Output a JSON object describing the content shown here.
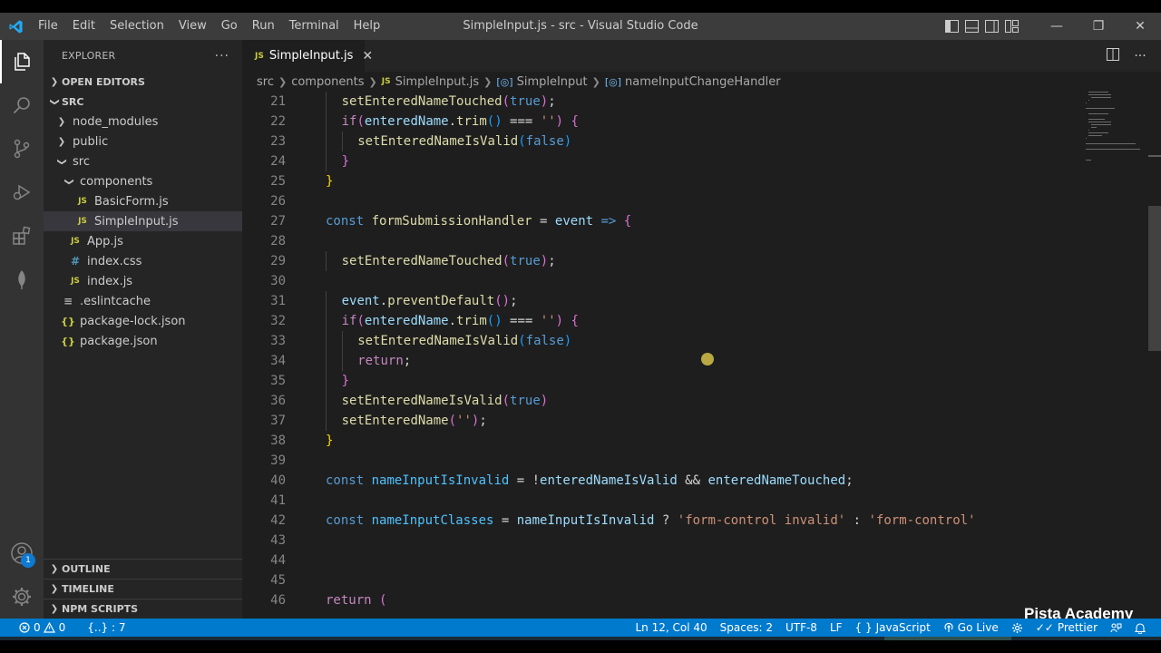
{
  "window": {
    "title": "SimpleInput.js - src - Visual Studio Code",
    "menu": [
      "File",
      "Edit",
      "Selection",
      "View",
      "Go",
      "Run",
      "Terminal",
      "Help"
    ],
    "controls": {
      "minimize": "—",
      "restore": "❐",
      "close": "✕"
    }
  },
  "activity_bar": {
    "items": [
      "explorer-icon",
      "search-icon",
      "source-control-icon",
      "run-debug-icon",
      "extensions-icon",
      "mongodb-leaf-icon"
    ],
    "bottom": [
      "account-icon",
      "settings-gear-icon"
    ],
    "account_badge": "1"
  },
  "sidebar": {
    "title": "EXPLORER",
    "more": "···",
    "open_editors": "OPEN EDITORS",
    "root": "SRC",
    "tree": [
      {
        "label": "node_modules",
        "type": "folder",
        "indent": 1,
        "expanded": false
      },
      {
        "label": "public",
        "type": "folder",
        "indent": 1,
        "expanded": false
      },
      {
        "label": "src",
        "type": "folder",
        "indent": 1,
        "expanded": true
      },
      {
        "label": "components",
        "type": "folder",
        "indent": 2,
        "expanded": true
      },
      {
        "label": "BasicForm.js",
        "type": "js",
        "indent": 3
      },
      {
        "label": "SimpleInput.js",
        "type": "js",
        "indent": 3,
        "selected": true
      },
      {
        "label": "App.js",
        "type": "js",
        "indent": 2
      },
      {
        "label": "index.css",
        "type": "css",
        "indent": 2
      },
      {
        "label": "index.js",
        "type": "js",
        "indent": 2
      },
      {
        "label": ".eslintcache",
        "type": "plain",
        "indent": 1
      },
      {
        "label": "package-lock.json",
        "type": "json",
        "indent": 1
      },
      {
        "label": "package.json",
        "type": "json",
        "indent": 1
      }
    ],
    "bottom_sections": [
      "OUTLINE",
      "TIMELINE",
      "NPM SCRIPTS"
    ]
  },
  "tab": {
    "icon": "JS",
    "label": "SimpleInput.js",
    "close": "✕"
  },
  "breadcrumbs": {
    "parts": [
      "src",
      "components",
      "SimpleInput.js",
      "SimpleInput",
      "nameInputChangeHandler"
    ]
  },
  "editor": {
    "lines": [
      {
        "n": "21",
        "indent": 1,
        "tokens": [
          [
            "fn",
            "setEnteredNameTouched"
          ],
          [
            "p2",
            "("
          ],
          [
            "kw",
            "true"
          ],
          [
            "p2",
            ")"
          ],
          [
            "op",
            ";"
          ]
        ]
      },
      {
        "n": "22",
        "indent": 1,
        "tokens": [
          [
            "ctrl",
            "if"
          ],
          [
            "p2",
            "("
          ],
          [
            "var",
            "enteredName"
          ],
          [
            "op",
            "."
          ],
          [
            "fn",
            "trim"
          ],
          [
            "p3",
            "()"
          ],
          [
            "op",
            " === "
          ],
          [
            "str",
            "''"
          ],
          [
            "p2",
            ")"
          ],
          [
            "op",
            " "
          ],
          [
            "p2",
            "{"
          ]
        ]
      },
      {
        "n": "23",
        "indent": 2,
        "tokens": [
          [
            "fn",
            "setEnteredNameIsValid"
          ],
          [
            "p3",
            "("
          ],
          [
            "kw",
            "false"
          ],
          [
            "p3",
            ")"
          ]
        ]
      },
      {
        "n": "24",
        "indent": 1,
        "tokens": [
          [
            "p2",
            "}"
          ]
        ]
      },
      {
        "n": "25",
        "indent": 0,
        "tokens": [
          [
            "p1",
            "}"
          ]
        ]
      },
      {
        "n": "26",
        "indent": 0,
        "tokens": []
      },
      {
        "n": "27",
        "indent": 0,
        "tokens": [
          [
            "kw",
            "const"
          ],
          [
            "op",
            " "
          ],
          [
            "fn",
            "formSubmissionHandler"
          ],
          [
            "op",
            " = "
          ],
          [
            "var",
            "event"
          ],
          [
            "op",
            " "
          ],
          [
            "kw",
            "=>"
          ],
          [
            "op",
            " "
          ],
          [
            "p2",
            "{"
          ]
        ]
      },
      {
        "n": "28",
        "indent": 0,
        "tokens": []
      },
      {
        "n": "29",
        "indent": 1,
        "tokens": [
          [
            "fn",
            "setEnteredNameTouched"
          ],
          [
            "p2",
            "("
          ],
          [
            "kw",
            "true"
          ],
          [
            "p2",
            ")"
          ],
          [
            "op",
            ";"
          ]
        ]
      },
      {
        "n": "30",
        "indent": 0,
        "tokens": []
      },
      {
        "n": "31",
        "indent": 1,
        "tokens": [
          [
            "var",
            "event"
          ],
          [
            "op",
            "."
          ],
          [
            "fn",
            "preventDefault"
          ],
          [
            "p2",
            "()"
          ],
          [
            "op",
            ";"
          ]
        ]
      },
      {
        "n": "32",
        "indent": 1,
        "tokens": [
          [
            "ctrl",
            "if"
          ],
          [
            "p2",
            "("
          ],
          [
            "var",
            "enteredName"
          ],
          [
            "op",
            "."
          ],
          [
            "fn",
            "trim"
          ],
          [
            "p3",
            "()"
          ],
          [
            "op",
            " === "
          ],
          [
            "str",
            "''"
          ],
          [
            "p2",
            ")"
          ],
          [
            "op",
            " "
          ],
          [
            "p2",
            "{"
          ]
        ]
      },
      {
        "n": "33",
        "indent": 2,
        "tokens": [
          [
            "fn",
            "setEnteredNameIsValid"
          ],
          [
            "p3",
            "("
          ],
          [
            "kw",
            "false"
          ],
          [
            "p3",
            ")"
          ]
        ]
      },
      {
        "n": "34",
        "indent": 2,
        "tokens": [
          [
            "ctrl",
            "return"
          ],
          [
            "op",
            ";"
          ]
        ]
      },
      {
        "n": "35",
        "indent": 1,
        "tokens": [
          [
            "p2",
            "}"
          ]
        ]
      },
      {
        "n": "36",
        "indent": 1,
        "tokens": [
          [
            "fn",
            "setEnteredNameIsValid"
          ],
          [
            "p2",
            "("
          ],
          [
            "kw",
            "true"
          ],
          [
            "p2",
            ")"
          ]
        ]
      },
      {
        "n": "37",
        "indent": 1,
        "tokens": [
          [
            "fn",
            "setEnteredName"
          ],
          [
            "p2",
            "("
          ],
          [
            "str",
            "''"
          ],
          [
            "p2",
            ")"
          ],
          [
            "op",
            ";"
          ]
        ]
      },
      {
        "n": "38",
        "indent": 0,
        "tokens": [
          [
            "p1",
            "}"
          ]
        ]
      },
      {
        "n": "39",
        "indent": 0,
        "tokens": []
      },
      {
        "n": "40",
        "indent": 0,
        "tokens": [
          [
            "kw",
            "const"
          ],
          [
            "op",
            " "
          ],
          [
            "const",
            "nameInputIsInvalid"
          ],
          [
            "op",
            " = !"
          ],
          [
            "var",
            "enteredNameIsValid"
          ],
          [
            "op",
            " && "
          ],
          [
            "var",
            "enteredNameTouched"
          ],
          [
            "op",
            ";"
          ]
        ]
      },
      {
        "n": "41",
        "indent": 0,
        "tokens": []
      },
      {
        "n": "42",
        "indent": 0,
        "tokens": [
          [
            "kw",
            "const"
          ],
          [
            "op",
            " "
          ],
          [
            "const",
            "nameInputClasses"
          ],
          [
            "op",
            " = "
          ],
          [
            "var",
            "nameInputIsInvalid"
          ],
          [
            "op",
            " ? "
          ],
          [
            "str",
            "'form-control invalid'"
          ],
          [
            "op",
            " : "
          ],
          [
            "str",
            "'form-control'"
          ]
        ]
      },
      {
        "n": "43",
        "indent": 0,
        "tokens": []
      },
      {
        "n": "44",
        "indent": 0,
        "tokens": []
      },
      {
        "n": "45",
        "indent": 0,
        "tokens": []
      },
      {
        "n": "46",
        "indent": 0,
        "tokens": [
          [
            "ctrl",
            "return"
          ],
          [
            "op",
            " "
          ],
          [
            "p2",
            "("
          ]
        ]
      }
    ]
  },
  "watermark": "Pista Academy",
  "statusbar": {
    "errors": "0",
    "warnings": "0",
    "selection": "{..} : 7",
    "position": "Ln 12, Col 40",
    "spaces": "Spaces: 2",
    "encoding": "UTF-8",
    "eol": "LF",
    "language": "JavaScript",
    "language_icon": "{ }",
    "golive": "Go Live",
    "prettier": "Prettier"
  },
  "colors": {
    "accent": "#007acc",
    "editor_bg": "#1e1e1e",
    "sidebar_bg": "#252526"
  }
}
